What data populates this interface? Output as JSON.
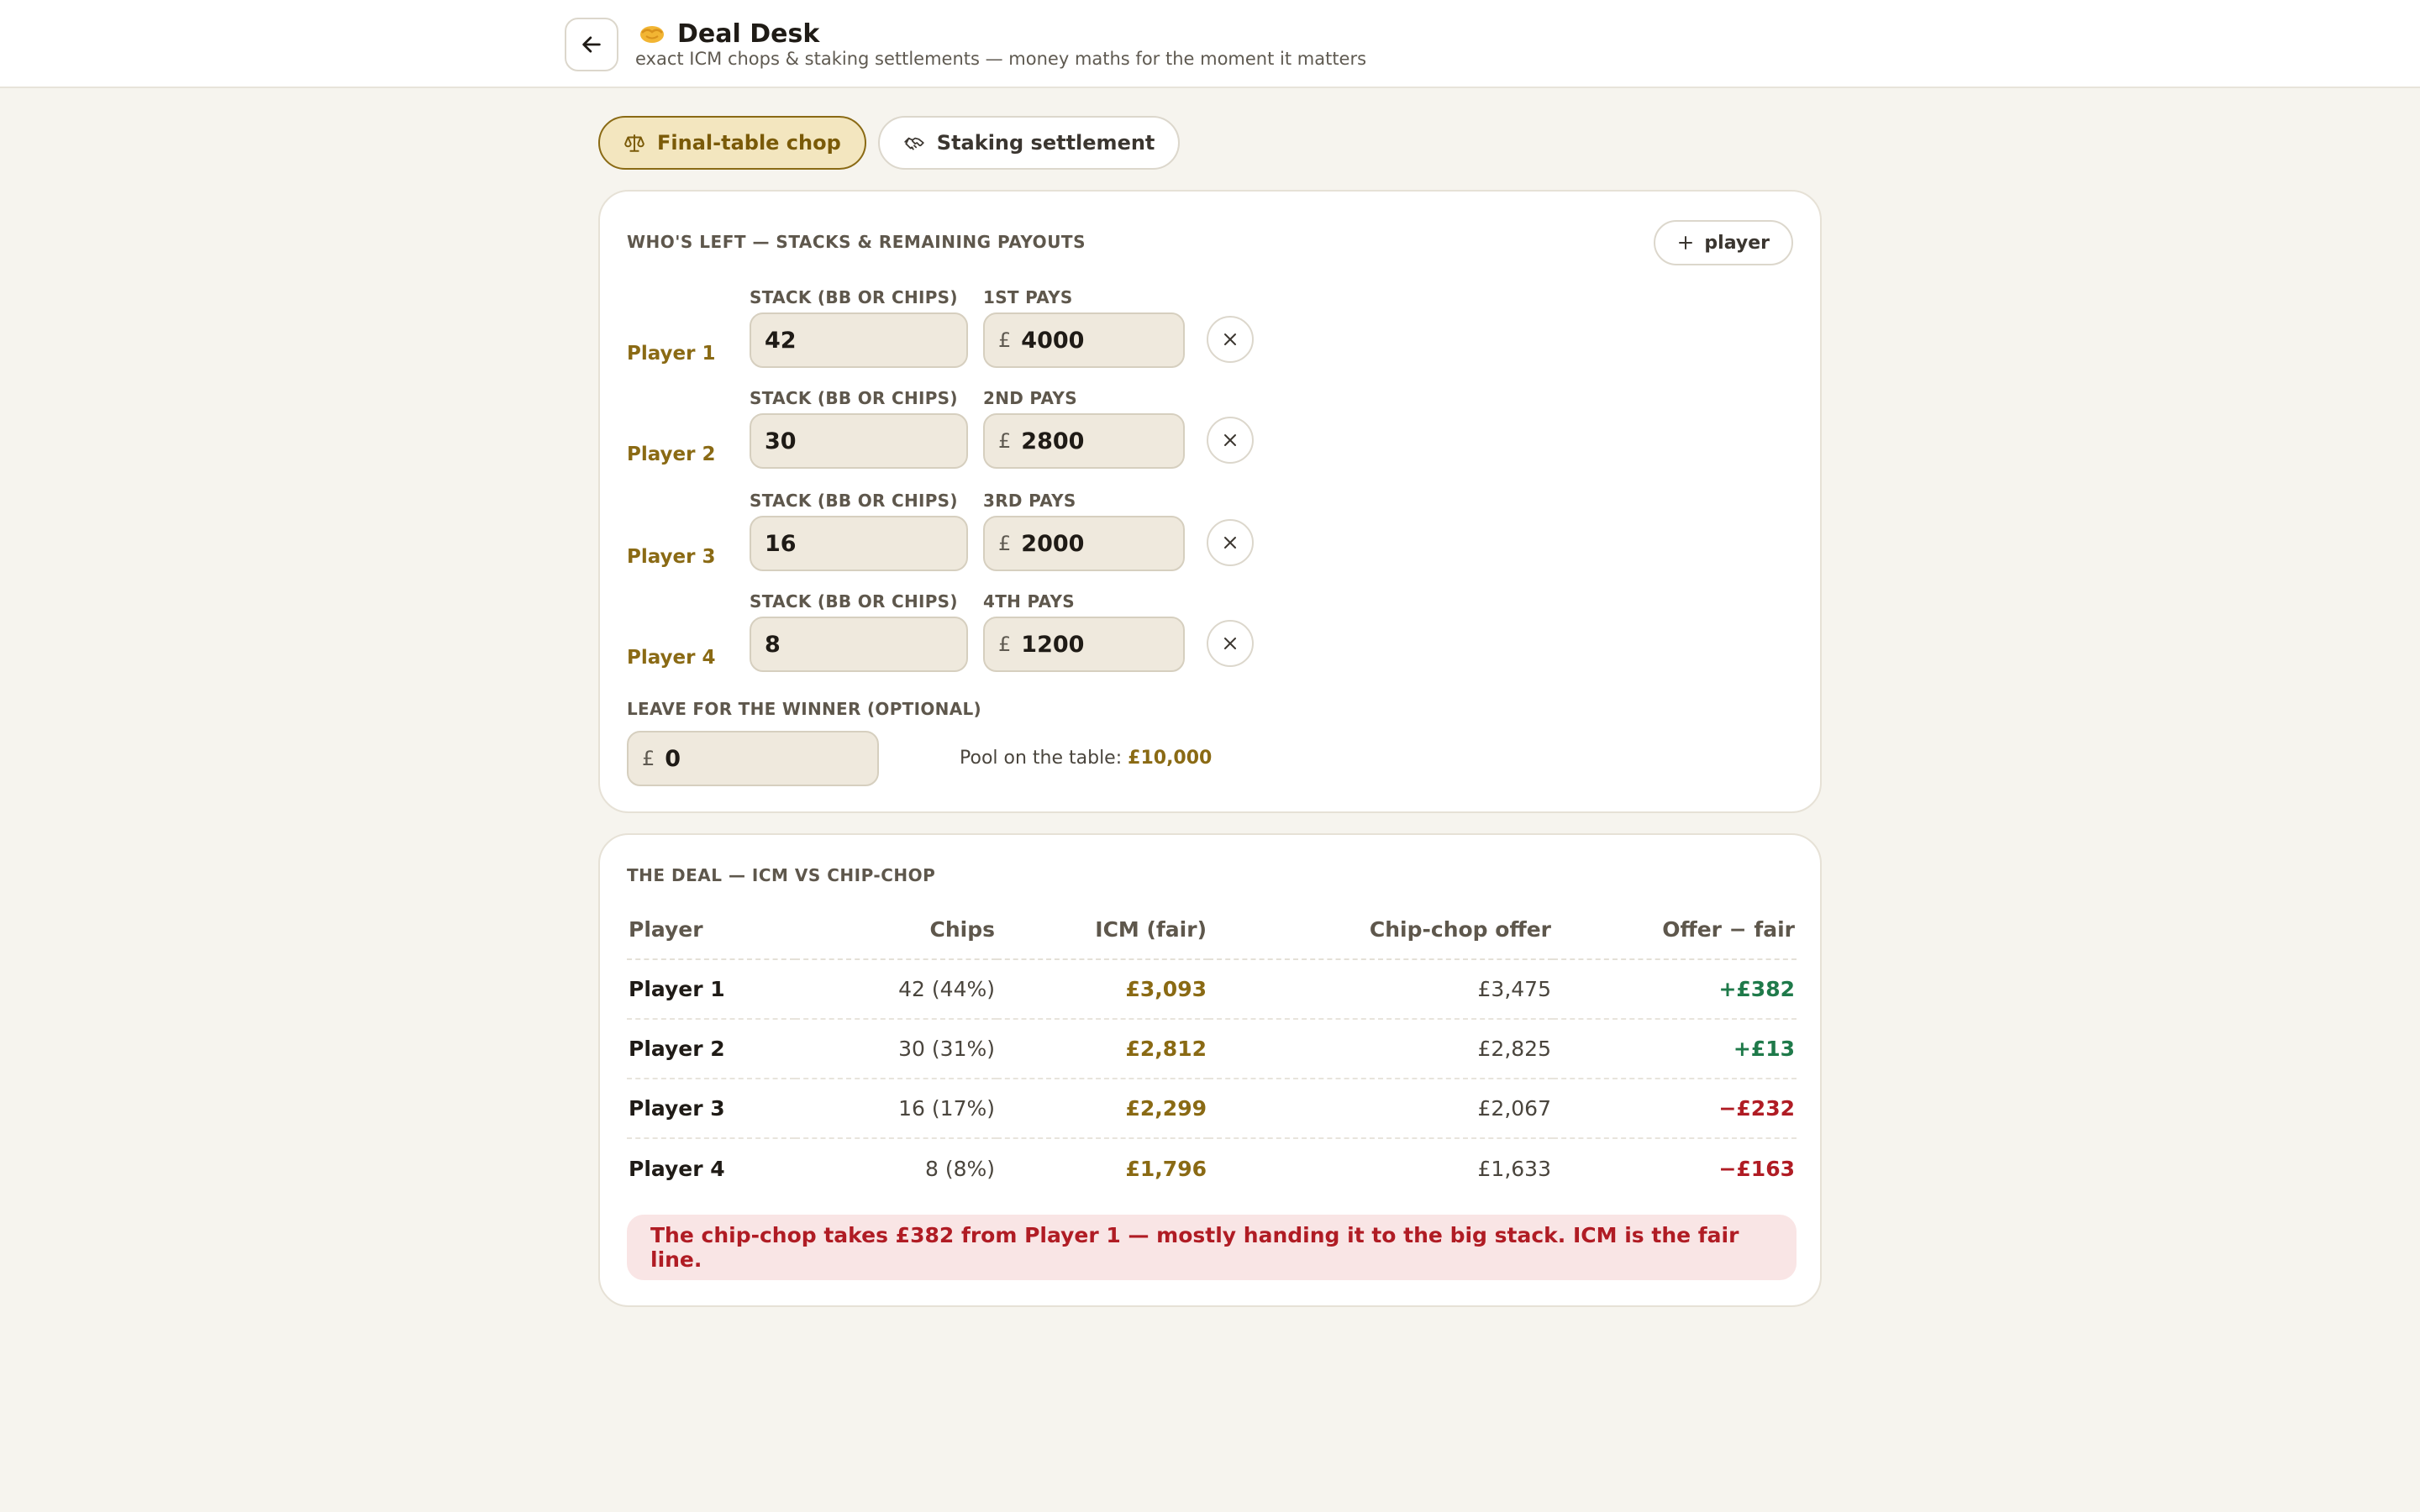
{
  "header": {
    "title": "Deal Desk",
    "subtitle": "exact ICM chops & staking settlements — money maths for the moment it matters"
  },
  "tabs": [
    {
      "label": "Final-table chop",
      "active": true,
      "icon": "scales-icon"
    },
    {
      "label": "Staking settlement",
      "active": false,
      "icon": "handshake-icon"
    }
  ],
  "players_section": {
    "title": "Who's left — stacks & remaining payouts",
    "add_player_label": "player",
    "stack_label": "Stack (BB or chips)",
    "currency": "£",
    "players": [
      {
        "name": "Player 1",
        "stack": "42",
        "pay_label": "1st pays",
        "payout": "4000"
      },
      {
        "name": "Player 2",
        "stack": "30",
        "pay_label": "2nd pays",
        "payout": "2800"
      },
      {
        "name": "Player 3",
        "stack": "16",
        "pay_label": "3rd pays",
        "payout": "2000"
      },
      {
        "name": "Player 4",
        "stack": "8",
        "pay_label": "4th pays",
        "payout": "1200"
      }
    ],
    "winner_label": "Leave for the winner (optional)",
    "winner_value": "0",
    "pool_label": "Pool on the table:",
    "pool_value": "£10,000"
  },
  "deal_section": {
    "title": "The deal — ICM vs chip-chop",
    "columns": [
      "Player",
      "Chips",
      "ICM (fair)",
      "Chip-chop offer",
      "Offer − fair"
    ],
    "rows": [
      {
        "player": "Player 1",
        "chips": "42 (44%)",
        "icm": "£3,093",
        "chipchop": "£3,475",
        "diff": "+£382"
      },
      {
        "player": "Player 2",
        "chips": "30 (31%)",
        "icm": "£2,812",
        "chipchop": "£2,825",
        "diff": "+£13"
      },
      {
        "player": "Player 3",
        "chips": "16 (17%)",
        "icm": "£2,299",
        "chipchop": "£2,067",
        "diff": "−£232"
      },
      {
        "player": "Player 4",
        "chips": "8 (8%)",
        "icm": "£1,796",
        "chipchop": "£1,633",
        "diff": "−£163"
      }
    ],
    "alert": "The chip-chop takes £382 from Player 1 — mostly handing it to the big stack. ICM is the fair line."
  },
  "colors": {
    "accent": "#8a6a14",
    "positive": "#1f7a4a",
    "negative": "#b01c24",
    "background": "#f6f4ee"
  }
}
